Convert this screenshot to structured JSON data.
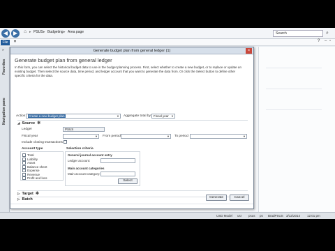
{
  "address_bar": {
    "back": "◀",
    "forward": "▶",
    "crumbs": [
      "PSUS",
      "Budgeting",
      "Area page"
    ],
    "search_placeholder": "Search",
    "search_icon": "search-icon"
  },
  "file_bar": {
    "file_label": "File"
  },
  "nav_pane": {
    "favorites": "Favorites",
    "navigation_pane": "Navigation pane"
  },
  "dialog": {
    "title": "Generate budget plan from general ledger (1)",
    "heading": "Generate budget plan from general ledger",
    "description": "In this form, you can select the historical budget data to use in the budget planning process. First, select whether to create a new budget, or to replace or update an existing budget. Then select the source data, time period, and ledger account that you want to generate the data from. Or click the Select button to define other specific criteria for the data.",
    "action_label": "Action:",
    "action_value": "Create a new budget plan",
    "aggregate_label": "Aggregate total by:",
    "aggregate_value": "Fiscal year",
    "source": {
      "title": "Source",
      "ledger_label": "Ledger",
      "ledger_value": "PSUS",
      "fiscal_year_label": "Fiscal year",
      "from_period_label": "From period",
      "to_period_label": "To period",
      "include_closing_label": "Include closing transactions",
      "account_type_title": "Account type",
      "account_types": [
        "Total",
        "Liability",
        "Asset",
        "Balance sheet",
        "Expense",
        "Revenue",
        "Profit and loss"
      ],
      "selection_title": "Selection criteria",
      "gl_entry_title": "General journal account entry",
      "ledger_account_label": "Ledger account:",
      "main_categories_title": "Main account categories",
      "main_category_label": "Main account category:",
      "select_button": "Select"
    },
    "target_title": "Target",
    "batch_title": "Batch",
    "generate_button": "Generate",
    "cancel_button": "Cancel"
  },
  "status_bar": {
    "items": [
      "USD Model",
      "usr",
      "psus",
      "ps",
      "BradPSUS",
      "3/12/2014",
      "12:01 pm"
    ]
  }
}
